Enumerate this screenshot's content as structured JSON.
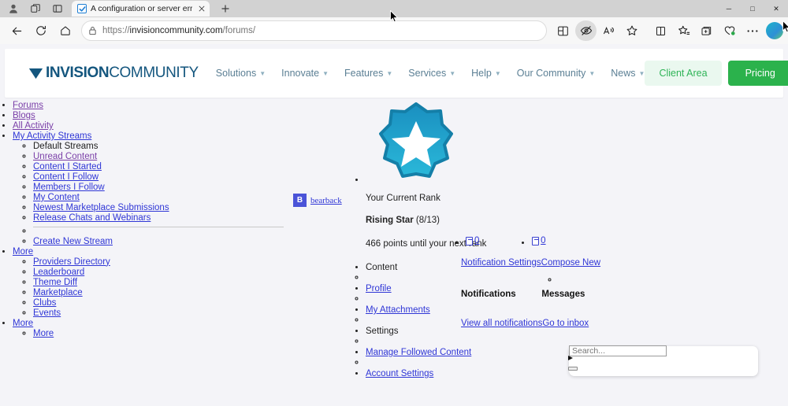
{
  "browser": {
    "tab": {
      "title": "A configuration or server error ha",
      "favicon": "checkbox-icon"
    },
    "new_tab_label": "+",
    "window_controls": {
      "minimize": "─",
      "maximize": "□",
      "close": "✕"
    },
    "url": {
      "scheme": "https://",
      "domain": "invisioncommunity.com",
      "path": "/forums/"
    },
    "nav_icons": [
      "back-icon",
      "refresh-icon",
      "home-icon"
    ],
    "toolbar_icons": [
      "split-screen-icon",
      "eye-slash-icon",
      "read-aloud-icon",
      "favorite-star-icon",
      "browser-split-icon",
      "favorites-add-icon",
      "collections-icon",
      "browser-essentials-icon",
      "settings-more-icon"
    ]
  },
  "site_header": {
    "logo": {
      "mark": "invision-chevron-icon",
      "bold": "INVISION",
      "light": "COMMUNITY"
    },
    "nav": [
      {
        "label": "Solutions",
        "has_caret": true
      },
      {
        "label": "Innovate",
        "has_caret": true
      },
      {
        "label": "Features",
        "has_caret": true
      },
      {
        "label": "Services",
        "has_caret": true
      },
      {
        "label": "Help",
        "has_caret": true
      },
      {
        "label": "Our Community",
        "has_caret": true
      },
      {
        "label": "News",
        "has_caret": true
      }
    ],
    "client_area_label": "Client Area",
    "pricing_label": "Pricing",
    "colors": {
      "brand": "#14567e",
      "nav_text": "#5b7f94",
      "green": "#2bb24c",
      "green_light": "#eaf8ef"
    }
  },
  "left_nav": {
    "top": [
      {
        "label": "Forums",
        "visited": true
      },
      {
        "label": "Blogs",
        "visited": true
      },
      {
        "label": "All Activity",
        "visited": true
      },
      {
        "label": "My Activity Streams",
        "visited": false
      }
    ],
    "streams": [
      {
        "label": "Default Streams",
        "link": false
      },
      {
        "label": "Unread Content",
        "link": true
      },
      {
        "label": "Content I Started",
        "link": true
      },
      {
        "label": "Content I Follow",
        "link": true
      },
      {
        "label": "Members I Follow",
        "link": true
      },
      {
        "label": "My Content",
        "link": true
      },
      {
        "label": "Newest Marketplace Submissions",
        "link": true
      },
      {
        "label": "Release Chats and Webinars",
        "link": true
      }
    ],
    "create_stream": "Create New Stream",
    "more_label": "More",
    "more_items": [
      "Providers Directory",
      "Leaderboard",
      "Theme Diff",
      "Marketplace",
      "Clubs",
      "Events"
    ],
    "more_label_2": "More",
    "more_item_2": "More"
  },
  "user": {
    "avatar_initial": "B",
    "name": "bearback"
  },
  "rank": {
    "badge_icon": "rank-star-badge-icon",
    "current_rank_label": "Your Current Rank",
    "rank_name": "Rising Star",
    "rank_progress": "(8/13)",
    "points_text": "466 points until your next rank",
    "badge_colors": {
      "top": "#1a8fc0",
      "bottom": "#2ab8d9",
      "border": "#147fa8",
      "star": "#ffffff"
    }
  },
  "counters": [
    {
      "icon": "broken-image-icon",
      "count": "0"
    },
    {
      "icon": "broken-image-icon",
      "count": "0"
    }
  ],
  "panel_links": {
    "notification_settings": "Notification Settings",
    "compose_new": "Compose New",
    "notifications_heading": "Notifications",
    "messages_heading": "Messages",
    "view_all_notifications": "View all notifications",
    "go_to_inbox": "Go to inbox"
  },
  "account_menu": [
    {
      "label": "Content",
      "link": false
    },
    {
      "label": "Profile",
      "link": true
    },
    {
      "label": "My Attachments",
      "link": true
    },
    {
      "label": "Settings",
      "link": false
    },
    {
      "label": "Manage Followed Content",
      "link": true
    },
    {
      "label": "Account Settings",
      "link": true
    }
  ],
  "search": {
    "placeholder": "Search...",
    "value": ""
  }
}
